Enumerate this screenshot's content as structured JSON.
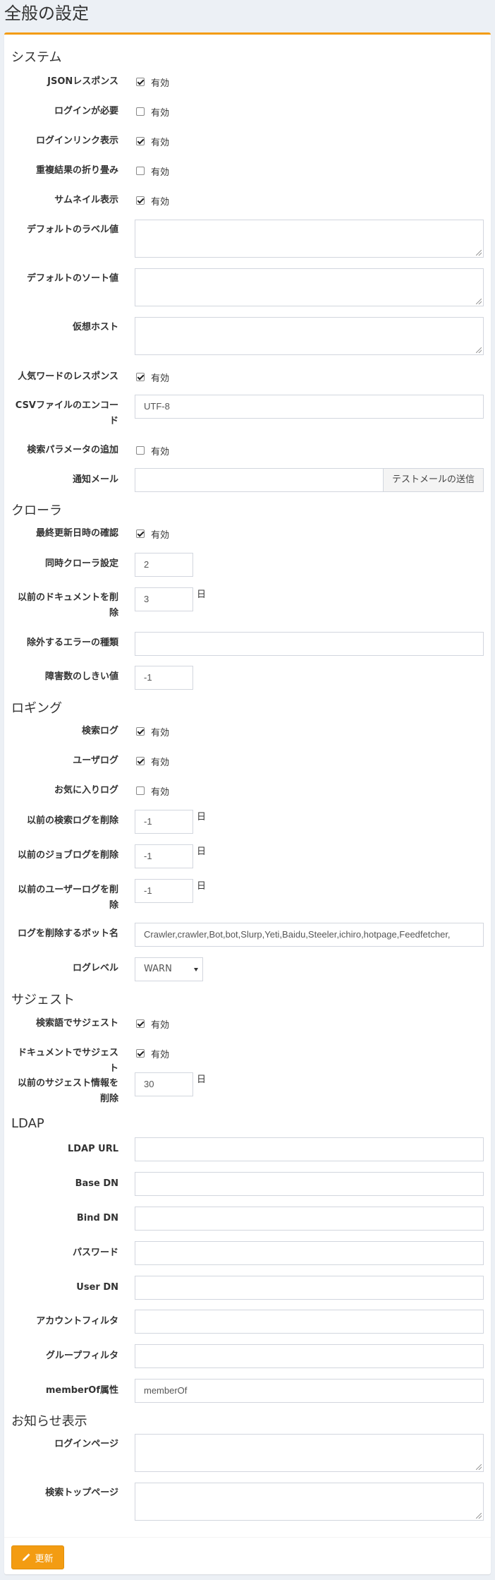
{
  "page": {
    "title": "全般の設定"
  },
  "common": {
    "enabled_label": "有効",
    "day_unit": "日"
  },
  "system": {
    "title": "システム",
    "json_response": {
      "label": "JSONレスポンス",
      "checked": true
    },
    "login_required": {
      "label": "ログインが必要",
      "checked": false
    },
    "login_link": {
      "label": "ログインリンク表示",
      "checked": true
    },
    "collapse_duplicates": {
      "label": "重複結果の折り畳み",
      "checked": false
    },
    "thumbnail": {
      "label": "サムネイル表示",
      "checked": true
    },
    "default_label": {
      "label": "デフォルトのラベル値",
      "value": ""
    },
    "default_sort": {
      "label": "デフォルトのソート値",
      "value": ""
    },
    "virtual_host": {
      "label": "仮想ホスト",
      "value": ""
    },
    "popular_word": {
      "label": "人気ワードのレスポンス",
      "checked": true
    },
    "csv_encoding": {
      "label": "CSVファイルのエンコード",
      "value": "UTF-8"
    },
    "append_query_param": {
      "label": "検索パラメータの追加",
      "checked": false
    },
    "notification_mail": {
      "label": "通知メール",
      "value": "",
      "button_label": "テストメールの送信"
    }
  },
  "crawler": {
    "title": "クローラ",
    "check_last_modified": {
      "label": "最終更新日時の確認",
      "checked": true
    },
    "concurrent_crawler": {
      "label": "同時クローラ設定",
      "value": "2"
    },
    "purge_docs": {
      "label": "以前のドキュメントを削除",
      "value": "3"
    },
    "ignore_errors": {
      "label": "除外するエラーの種類",
      "value": ""
    },
    "failure_threshold": {
      "label": "障害数のしきい値",
      "value": "-1"
    }
  },
  "logging": {
    "title": "ロギング",
    "search_log": {
      "label": "検索ログ",
      "checked": true
    },
    "user_log": {
      "label": "ユーザログ",
      "checked": true
    },
    "favorite_log": {
      "label": "お気に入りログ",
      "checked": false
    },
    "purge_search_log": {
      "label": "以前の検索ログを削除",
      "value": "-1"
    },
    "purge_job_log": {
      "label": "以前のジョブログを削除",
      "value": "-1"
    },
    "purge_user_log": {
      "label": "以前のユーザーログを削除",
      "value": "-1"
    },
    "purge_bot_names": {
      "label": "ログを削除するボット名",
      "value": "Crawler,crawler,Bot,bot,Slurp,Yeti,Baidu,Steeler,ichiro,hotpage,Feedfetcher,"
    },
    "log_level": {
      "label": "ログレベル",
      "value": "WARN"
    }
  },
  "suggest": {
    "title": "サジェスト",
    "suggest_search_log": {
      "label": "検索語でサジェスト",
      "checked": true
    },
    "suggest_documents": {
      "label": "ドキュメントでサジェスト",
      "checked": true
    },
    "purge_suggest": {
      "label": "以前のサジェスト情報を削除",
      "value": "30"
    }
  },
  "ldap": {
    "title": "LDAP",
    "url": {
      "label": "LDAP URL",
      "value": ""
    },
    "base_dn": {
      "label": "Base DN",
      "value": ""
    },
    "bind_dn": {
      "label": "Bind DN",
      "value": ""
    },
    "password": {
      "label": "パスワード",
      "value": ""
    },
    "user_dn": {
      "label": "User DN",
      "value": ""
    },
    "account_filter": {
      "label": "アカウントフィルタ",
      "value": ""
    },
    "group_filter": {
      "label": "グループフィルタ",
      "value": ""
    },
    "member_of": {
      "label": "memberOf属性",
      "value": "memberOf"
    }
  },
  "notice": {
    "title": "お知らせ表示",
    "login_page": {
      "label": "ログインページ",
      "value": ""
    },
    "search_top_page": {
      "label": "検索トップページ",
      "value": ""
    }
  },
  "footer": {
    "update_label": "更新"
  },
  "colors": {
    "accent": "#f39c12",
    "background": "#ecf0f5",
    "border": "#d2d6de"
  }
}
